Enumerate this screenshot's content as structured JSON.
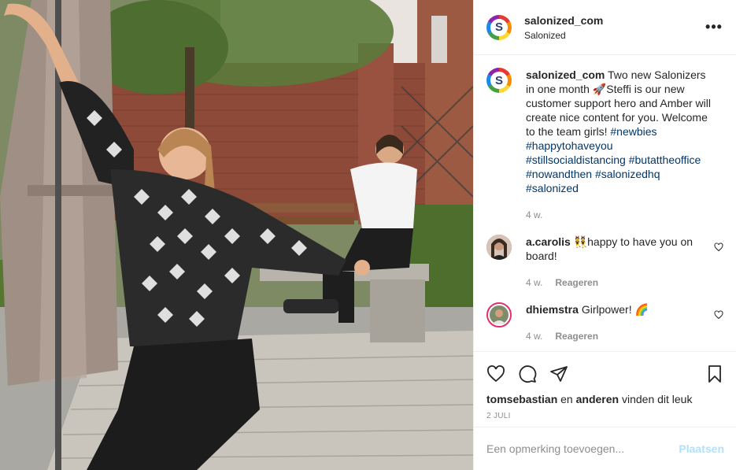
{
  "header": {
    "username": "salonized_com",
    "subtitle": "Salonized",
    "avatar_letter": "S",
    "more": "•••"
  },
  "caption": {
    "username": "salonized_com",
    "text_before": "Two new Salonizers in one month 🚀Steffi is our new customer support hero and Amber will create nice content for you. Welcome to the team girls!",
    "hashtags": [
      "#newbies",
      "#happytohaveyou",
      "#stillsocialdistancing",
      "#butattheoffice",
      "#nowandthen",
      "#salonizedhq",
      "#salonized"
    ],
    "time": "4 w."
  },
  "comments": [
    {
      "username": "a.carolis",
      "text": "👯happy to have you on board!",
      "time": "4 w.",
      "reply": "Reageren"
    },
    {
      "username": "dhiemstra",
      "text": "Girlpower! 🌈",
      "time": "4 w.",
      "reply": "Reageren"
    }
  ],
  "likes": {
    "user": "tomsebastian",
    "connector": "en",
    "others": "anderen",
    "suffix": "vinden dit leuk"
  },
  "date": "2 JULI",
  "add_comment": {
    "placeholder": "Een opmerking toevoegen...",
    "post": "Plaatsen"
  },
  "colors": {
    "link": "#00376b",
    "muted": "#8e8e8e",
    "post_disabled": "#b2dffc"
  },
  "icons": [
    "heart-icon",
    "comment-icon",
    "share-icon",
    "bookmark-icon",
    "more-icon"
  ]
}
